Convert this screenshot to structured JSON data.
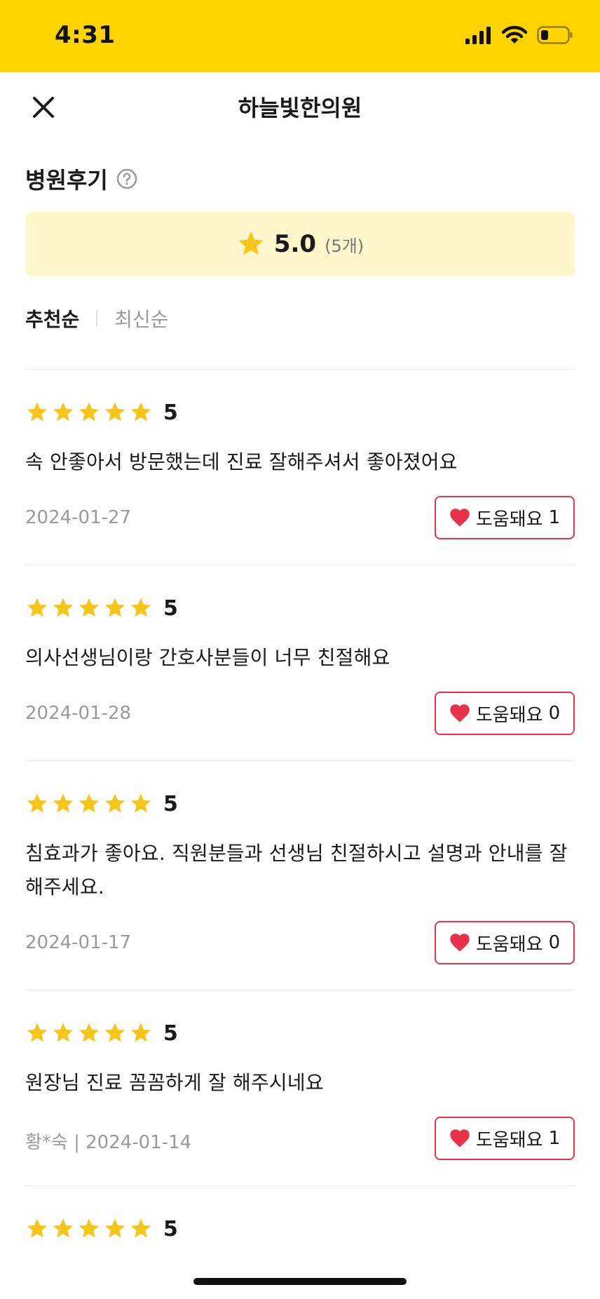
{
  "status_bar": {
    "time": "4:31"
  },
  "nav": {
    "title": "하늘빛한의원"
  },
  "section": {
    "title": "병원후기"
  },
  "summary": {
    "score": "5.0",
    "count": "(5개)"
  },
  "sort": {
    "active": "추천순",
    "inactive": "최신순"
  },
  "reviews": [
    {
      "rating": "5",
      "text": "속 안좋아서 방문했는데 진료 잘해주셔서 좋아졌어요",
      "meta": "2024-01-27",
      "helpful_label": "도움돼요",
      "helpful_count": "1"
    },
    {
      "rating": "5",
      "text": "의사선생님이랑 간호사분들이 너무 친절해요",
      "meta": "2024-01-28",
      "helpful_label": "도움돼요",
      "helpful_count": "0"
    },
    {
      "rating": "5",
      "text": "침효과가 좋아요. 직원분들과 선생님 친절하시고 설명과 안내를 잘 해주세요.",
      "meta": "2024-01-17",
      "helpful_label": "도움돼요",
      "helpful_count": "0"
    },
    {
      "rating": "5",
      "text": "원장님 진료 꼼꼼하게 잘 해주시네요",
      "meta": "황*숙 | 2024-01-14",
      "helpful_label": "도움돼요",
      "helpful_count": "1"
    },
    {
      "rating": "5"
    }
  ],
  "colors": {
    "brand_yellow": "#FFD400",
    "star": "#F5C518",
    "heart": "#E8324B",
    "summary_bg": "#FFF6CC"
  }
}
